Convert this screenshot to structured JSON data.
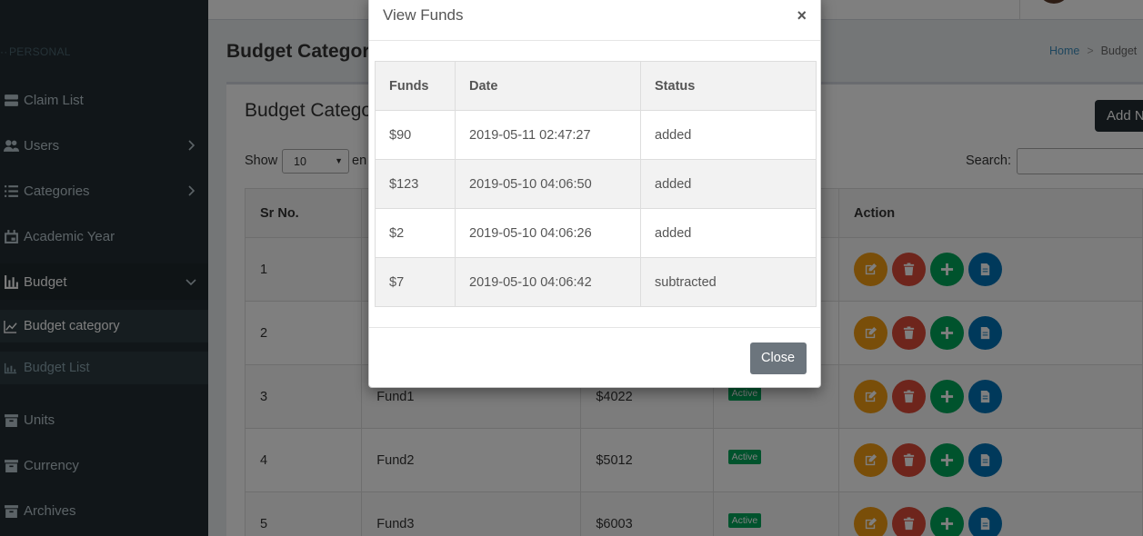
{
  "sidebar": {
    "section_header": "PERSONAL",
    "items": [
      {
        "label": "Claim List",
        "icon": "server-icon"
      },
      {
        "label": "Users",
        "icon": "users-icon"
      },
      {
        "label": "Categories",
        "icon": "list-icon"
      },
      {
        "label": "Academic Year",
        "icon": "calendar-icon"
      },
      {
        "label": "Budget",
        "icon": "bar-chart-icon"
      },
      {
        "label": "Units",
        "icon": "archive-icon"
      },
      {
        "label": "Currency",
        "icon": "archive-icon"
      },
      {
        "label": "Archives",
        "icon": "archive-icon"
      }
    ],
    "budget_sub": [
      {
        "label": "Budget category",
        "icon": "line-chart-icon"
      },
      {
        "label": "Budget List",
        "icon": "bar-chart-icon"
      }
    ]
  },
  "page": {
    "title": "Budget Categor",
    "breadcrumb_home": "Home",
    "breadcrumb_current": "Budget",
    "box_title": "Budget Catego",
    "add_button": "Add N",
    "show_label": "Show",
    "show_value": "10",
    "show_suffix": "en",
    "search_label": "Search:",
    "search_value": ""
  },
  "table": {
    "headers": [
      "Sr No.",
      "",
      "",
      "",
      "Action"
    ],
    "rows": [
      {
        "sr": "1",
        "name": "",
        "amount": "",
        "status": ""
      },
      {
        "sr": "2",
        "name": "",
        "amount": "",
        "status": ""
      },
      {
        "sr": "3",
        "name": "Fund1",
        "amount": "$4022",
        "status": "Active"
      },
      {
        "sr": "4",
        "name": "Fund2",
        "amount": "$5012",
        "status": "Active"
      },
      {
        "sr": "5",
        "name": "Fund3",
        "amount": "$6003",
        "status": "Active"
      }
    ]
  },
  "modal": {
    "title": "View Funds",
    "close_x": "×",
    "headers": [
      "Funds",
      "Date",
      "Status"
    ],
    "rows": [
      {
        "funds": "$90",
        "date": "2019-05-11 02:47:27",
        "status": "added"
      },
      {
        "funds": "$123",
        "date": "2019-05-10 04:06:50",
        "status": "added"
      },
      {
        "funds": "$2",
        "date": "2019-05-10 04:06:26",
        "status": "added"
      },
      {
        "funds": "$7",
        "date": "2019-05-10 04:06:42",
        "status": "subtracted"
      }
    ],
    "close_button": "Close"
  },
  "colors": {
    "sidebar_bg": "#222d32",
    "accent_dark": "#222d32",
    "edit": "#f39c12",
    "delete": "#dd4b39",
    "add": "#00a65a",
    "doc": "#0073b7",
    "active_badge": "#00a65a",
    "close_button": "#6c757d"
  }
}
